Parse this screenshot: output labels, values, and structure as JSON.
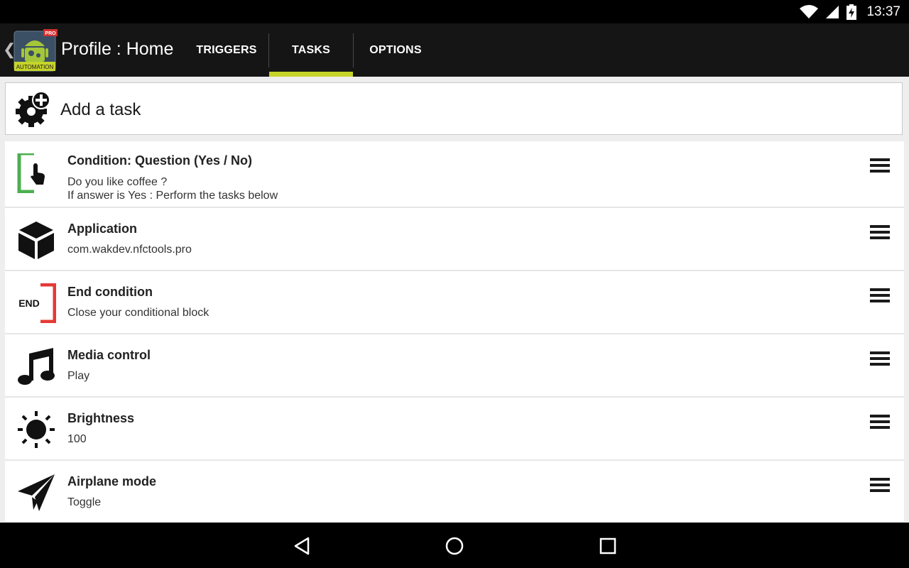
{
  "status": {
    "time": "13:37"
  },
  "header": {
    "title": "Profile : Home",
    "app_badge": "PRO",
    "app_label": "AUTOMATION",
    "tabs": [
      {
        "label": "TRIGGERS",
        "active": false
      },
      {
        "label": "TASKS",
        "active": true
      },
      {
        "label": "OPTIONS",
        "active": false
      }
    ]
  },
  "add_task": {
    "label": "Add a task"
  },
  "tasks": [
    {
      "title": "Condition: Question (Yes / No)",
      "desc1": "Do you like coffee ?",
      "desc2": "If answer is Yes : Perform the tasks below",
      "icon": "condition-question-icon"
    },
    {
      "title": "Application",
      "desc1": "com.wakdev.nfctools.pro",
      "icon": "cube-icon"
    },
    {
      "title": "End condition",
      "desc1": "Close your conditional block",
      "icon": "end-condition-icon",
      "icon_text": "END"
    },
    {
      "title": "Media control",
      "desc1": "Play",
      "icon": "music-note-icon"
    },
    {
      "title": "Brightness",
      "desc1": "100",
      "icon": "sun-icon"
    },
    {
      "title": "Airplane mode",
      "desc1": "Toggle",
      "icon": "paper-plane-icon"
    }
  ],
  "colors": {
    "accent": "#c6d42a",
    "condition_green": "#4caf50",
    "end_red": "#e53935"
  }
}
